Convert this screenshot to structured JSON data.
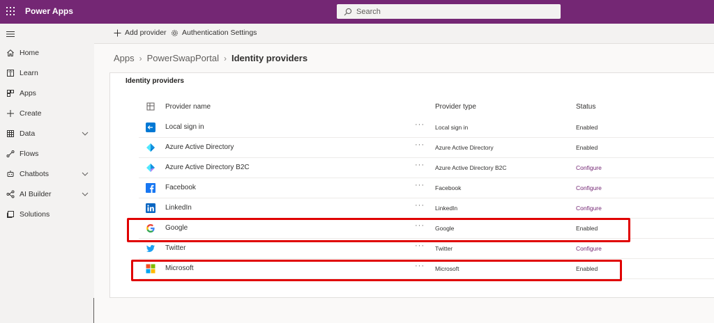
{
  "app": {
    "title": "Power Apps"
  },
  "search": {
    "placeholder": "Search"
  },
  "sidebar": {
    "items": [
      {
        "label": "Home",
        "icon": "home-icon"
      },
      {
        "label": "Learn",
        "icon": "book-icon"
      },
      {
        "label": "Apps",
        "icon": "apps-icon"
      },
      {
        "label": "Create",
        "icon": "plus-icon"
      },
      {
        "label": "Data",
        "icon": "table-icon",
        "expandable": true
      },
      {
        "label": "Flows",
        "icon": "flow-icon"
      },
      {
        "label": "Chatbots",
        "icon": "bot-icon",
        "expandable": true
      },
      {
        "label": "AI Builder",
        "icon": "ai-icon",
        "expandable": true
      },
      {
        "label": "Solutions",
        "icon": "solutions-icon"
      }
    ]
  },
  "commands": {
    "add_provider": "Add provider",
    "auth_settings": "Authentication Settings"
  },
  "breadcrumb": {
    "apps": "Apps",
    "portal": "PowerSwapPortal",
    "current": "Identity providers"
  },
  "card": {
    "title": "Identity providers",
    "columns": {
      "name": "Provider name",
      "type": "Provider type",
      "status": "Status"
    }
  },
  "providers": [
    {
      "name": "Local sign in",
      "type": "Local sign in",
      "status": "Enabled",
      "icon": "local-signin-icon"
    },
    {
      "name": "Azure Active Directory",
      "type": "Azure Active Directory",
      "status": "Enabled",
      "icon": "azure-ad-icon"
    },
    {
      "name": "Azure Active Directory B2C",
      "type": "Azure Active Directory B2C",
      "status": "Configure",
      "icon": "azure-ad-b2c-icon"
    },
    {
      "name": "Facebook",
      "type": "Facebook",
      "status": "Configure",
      "icon": "facebook-icon"
    },
    {
      "name": "LinkedIn",
      "type": "LinkedIn",
      "status": "Configure",
      "icon": "linkedin-icon"
    },
    {
      "name": "Google",
      "type": "Google",
      "status": "Enabled",
      "icon": "google-icon"
    },
    {
      "name": "Twitter",
      "type": "Twitter",
      "status": "Configure",
      "icon": "twitter-icon"
    },
    {
      "name": "Microsoft",
      "type": "Microsoft",
      "status": "Enabled",
      "icon": "microsoft-icon"
    }
  ],
  "colors": {
    "brand": "#742774",
    "highlight": "#e00000",
    "configure_link": "#742774"
  },
  "more_glyph": "···"
}
